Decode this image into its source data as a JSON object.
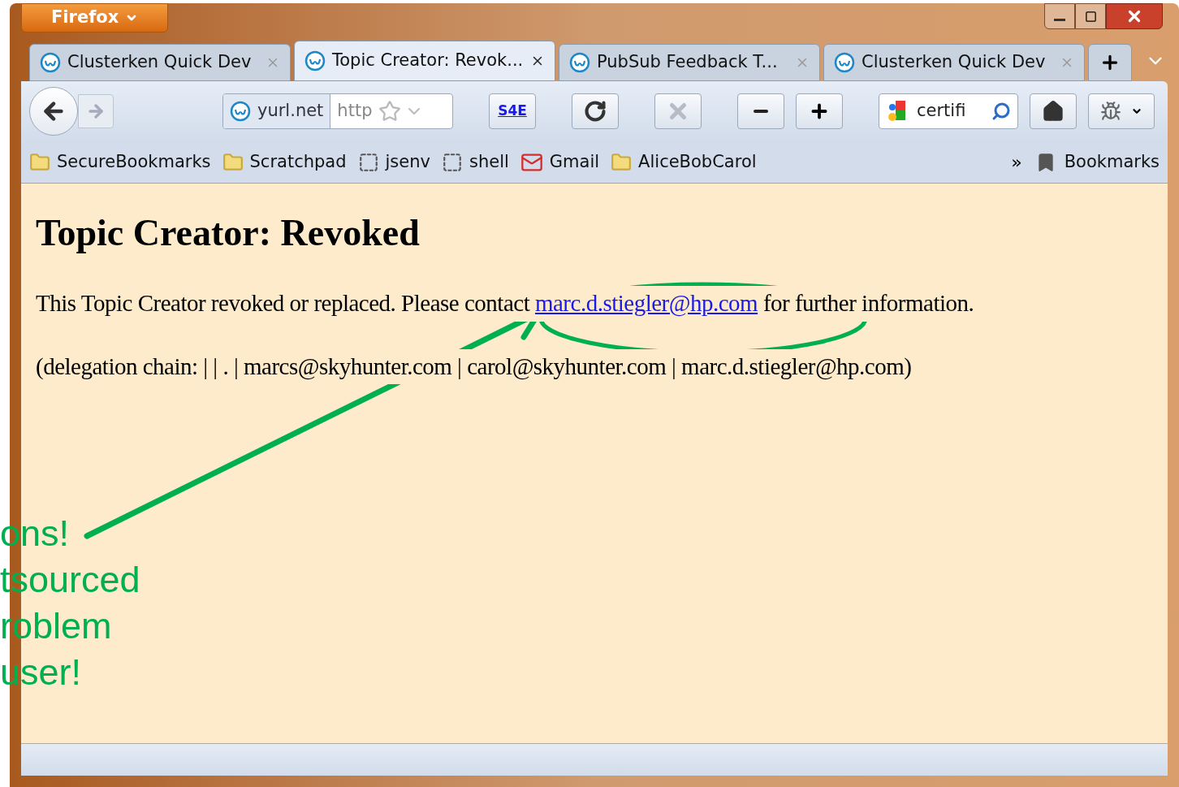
{
  "menu_button": {
    "label": "Firefox"
  },
  "tabs": [
    {
      "title": "Clusterken Quick Dev",
      "selected": false
    },
    {
      "title": "Topic Creator: Revok...",
      "selected": true
    },
    {
      "title": "PubSub Feedback T...",
      "selected": false
    },
    {
      "title": "Clusterken Quick Dev",
      "selected": false
    }
  ],
  "nav": {
    "back": {
      "disabled": false
    },
    "forward": {
      "disabled": true
    },
    "address": {
      "site": "yurl.net",
      "value": "http"
    },
    "s4e": {
      "label": "S4E"
    },
    "reload": {
      "disabled": false
    },
    "stop": {
      "disabled": true
    },
    "search": {
      "value": "certifi"
    }
  },
  "bookmarks": {
    "items": [
      {
        "label": "SecureBookmarks",
        "kind": "folder"
      },
      {
        "label": "Scratchpad",
        "kind": "folder"
      },
      {
        "label": "jsenv",
        "kind": "page"
      },
      {
        "label": "shell",
        "kind": "page"
      },
      {
        "label": "Gmail",
        "kind": "mail"
      },
      {
        "label": "AliceBobCarol",
        "kind": "folder"
      }
    ],
    "overflow": "»",
    "menu": "Bookmarks"
  },
  "page": {
    "heading": "Topic Creator: Revoked",
    "message": {
      "before": "This Topic Creator revoked or replaced. Please contact ",
      "link": "marc.d.stiegler@hp.com",
      "after": " for further information."
    },
    "chain": "(delegation chain: | | . | marcs@skyhunter.com | carol@skyhunter.com | marc.d.stiegler@hp.com)"
  },
  "annotation": [
    "ons!",
    "tsourced",
    "roblem",
    "user!"
  ]
}
